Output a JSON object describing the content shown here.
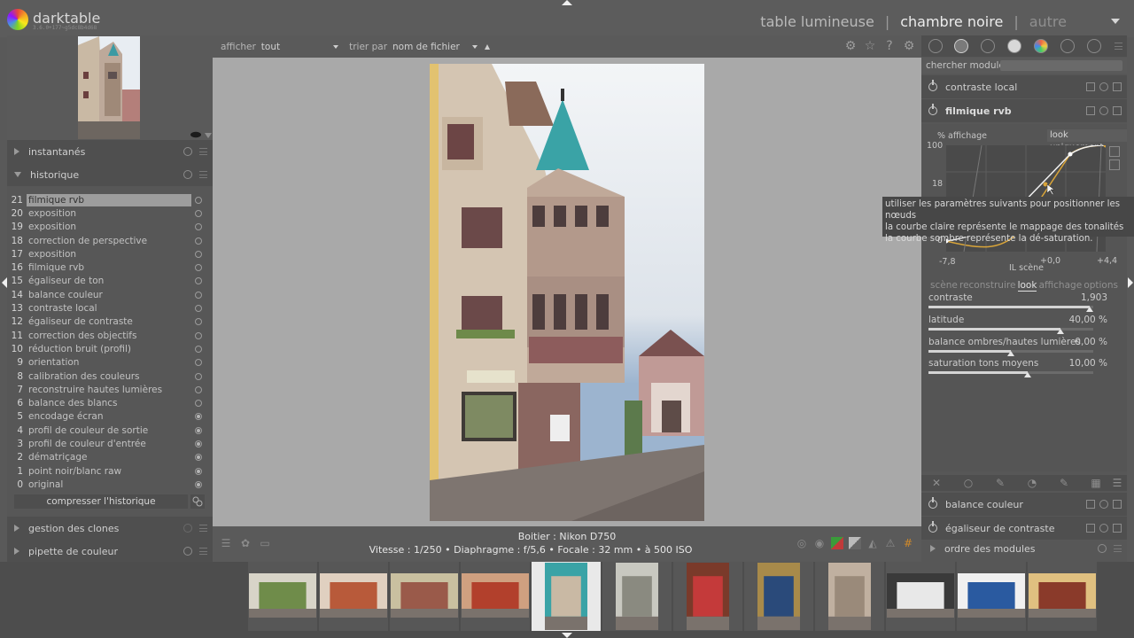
{
  "app": {
    "name": "darktable",
    "version": "3.6.0+177~g5dc8b4d68"
  },
  "views": [
    "table lumineuse",
    "chambre noire",
    "autre"
  ],
  "active_view": "chambre noire",
  "left_panel": {
    "modules": {
      "snapshots": "instantanés",
      "history": "historique",
      "clones": "gestion des clones",
      "picker": "pipette de couleur"
    },
    "history": [
      {
        "n": "21",
        "name": "filmique rvb",
        "selected": true,
        "state": "off"
      },
      {
        "n": "20",
        "name": "exposition",
        "state": "off"
      },
      {
        "n": "19",
        "name": "exposition",
        "state": "off"
      },
      {
        "n": "18",
        "name": "correction de perspective",
        "state": "off"
      },
      {
        "n": "17",
        "name": "exposition",
        "state": "off"
      },
      {
        "n": "16",
        "name": "filmique rvb",
        "state": "off"
      },
      {
        "n": "15",
        "name": "égaliseur de ton",
        "state": "off"
      },
      {
        "n": "14",
        "name": "balance couleur",
        "state": "off"
      },
      {
        "n": "13",
        "name": "contraste local",
        "state": "off"
      },
      {
        "n": "12",
        "name": "égaliseur de contraste",
        "state": "off"
      },
      {
        "n": "11",
        "name": "correction des objectifs",
        "state": "off"
      },
      {
        "n": "10",
        "name": "réduction bruit (profil)",
        "state": "off"
      },
      {
        "n": "9",
        "name": "orientation",
        "state": "off"
      },
      {
        "n": "8",
        "name": "calibration des couleurs",
        "state": "off"
      },
      {
        "n": "7",
        "name": "reconstruire hautes lumières",
        "state": "off"
      },
      {
        "n": "6",
        "name": "balance des blancs",
        "state": "off"
      },
      {
        "n": "5",
        "name": "encodage écran",
        "state": "on"
      },
      {
        "n": "4",
        "name": "profil de couleur de sortie",
        "state": "on"
      },
      {
        "n": "3",
        "name": "profil de couleur d'entrée",
        "state": "on"
      },
      {
        "n": "2",
        "name": "dématriçage",
        "state": "on"
      },
      {
        "n": "1",
        "name": "point noir/blanc raw",
        "state": "on"
      },
      {
        "n": "0",
        "name": "original",
        "state": "on"
      }
    ],
    "compress_label": "compresser l'historique"
  },
  "center": {
    "show_label": "afficher",
    "show_value": "tout",
    "sort_label": "trier par",
    "sort_value": "nom de fichier",
    "info_line1": "Boitier : Nikon D750",
    "info_line2": "Vitesse : 1/250  •  Diaphragme : f/5,6  •  Focale : 32 mm  •  à 500 ISO"
  },
  "right_panel": {
    "search_label": "chercher module",
    "modules": {
      "local_contrast": "contraste local",
      "filmic": "filmique rvb",
      "color_balance": "balance couleur",
      "contrast_eq": "égaliseur de contraste",
      "module_order": "ordre des modules"
    },
    "filmic": {
      "graph_title": "% affichage",
      "look_button": "look uniquement",
      "y_ticks": [
        "100",
        "18",
        "0"
      ],
      "x_ticks": [
        "-7,8",
        "+0,0",
        "+4,4"
      ],
      "x_label": "IL scène",
      "tabs": [
        "scène",
        "reconstruire",
        "look",
        "affichage",
        "options"
      ],
      "active_tab": "look",
      "sliders": [
        {
          "name": "contraste",
          "value": "1,903",
          "level": 0.98
        },
        {
          "name": "latitude",
          "value": "40,00 %",
          "level": 0.8
        },
        {
          "name": "balance ombres/hautes lumières",
          "value": "0,00 %",
          "level": 0.5
        },
        {
          "name": "saturation tons moyens",
          "value": "10,00 %",
          "level": 0.6
        }
      ]
    }
  },
  "tooltip": {
    "line1": "utiliser les paramètres suivants pour positionner les nœuds",
    "line2": "la courbe claire représente le mappage des tonalités",
    "line3": "la courbe sombre représente la dé-saturation."
  },
  "filmstrip": {
    "current_index": 4
  },
  "colors": {
    "accent_curve": "#d9a53a",
    "panel_bg": "#575757",
    "center_bg": "#a9a9a9"
  }
}
